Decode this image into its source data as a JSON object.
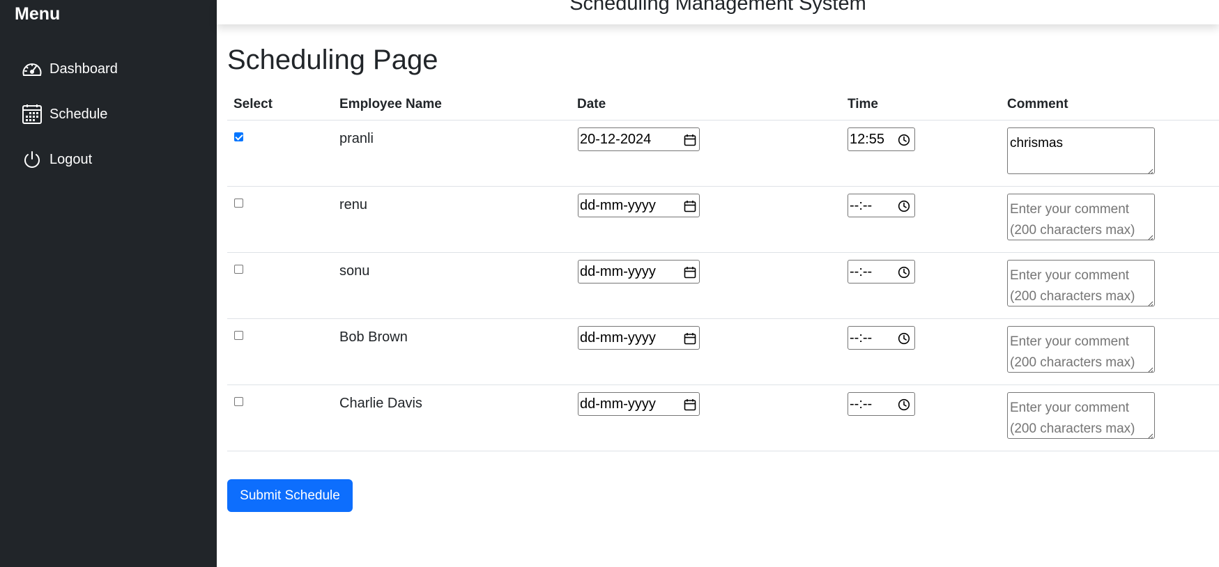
{
  "sidebar": {
    "title": "Menu",
    "items": [
      {
        "label": "Dashboard",
        "icon": "speedometer-icon"
      },
      {
        "label": "Schedule",
        "icon": "calendar-icon"
      },
      {
        "label": "Logout",
        "icon": "power-icon"
      }
    ]
  },
  "header": {
    "title": "Scheduling Management System"
  },
  "page": {
    "title": "Scheduling Page"
  },
  "table": {
    "columns": [
      "Select",
      "Employee Name",
      "Date",
      "Time",
      "Comment"
    ],
    "rows": [
      {
        "selected": true,
        "name": "pranli",
        "date": "20-12-2024",
        "time": "12:55",
        "comment": "chrismas"
      },
      {
        "selected": false,
        "name": "renu",
        "date": "dd-mm-yyyy",
        "time": "--:--",
        "comment": ""
      },
      {
        "selected": false,
        "name": "sonu",
        "date": "dd-mm-yyyy",
        "time": "--:--",
        "comment": ""
      },
      {
        "selected": false,
        "name": "Bob Brown",
        "date": "dd-mm-yyyy",
        "time": "--:--",
        "comment": ""
      },
      {
        "selected": false,
        "name": "Charlie Davis",
        "date": "dd-mm-yyyy",
        "time": "--:--",
        "comment": ""
      }
    ],
    "comment_placeholder": "Enter your comment (200 characters max)"
  },
  "actions": {
    "submit_label": "Submit Schedule"
  },
  "colors": {
    "sidebar_bg": "#212529",
    "primary": "#0d6efd",
    "checkbox_checked": "#0075ff"
  }
}
